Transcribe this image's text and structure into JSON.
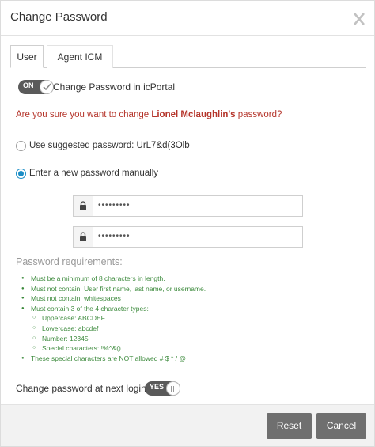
{
  "dialog": {
    "title": "Change Password",
    "close_icon": "close-icon"
  },
  "tabs": [
    {
      "label": "User",
      "active": true
    },
    {
      "label": "Agent ICM",
      "active": false
    }
  ],
  "portal_toggle": {
    "state_label": "ON",
    "label": "Change Password in icPortal",
    "enabled": true
  },
  "confirmation": {
    "prefix": "Are you sure you want to change ",
    "user": "Lionel Mclaughlin's",
    "suffix": " password?"
  },
  "options": {
    "suggested": {
      "label": "Use suggested password: UrL7&d(3Olb",
      "selected": false
    },
    "manual": {
      "label": "Enter a new password manually",
      "selected": true
    }
  },
  "password_fields": {
    "new_value": "•••••••••",
    "confirm_value": "•••••••••"
  },
  "requirements": {
    "title": "Password requirements:",
    "items": [
      "Must be a minimum of 8 characters in length.",
      "Must not contain: User first name, last name, or username.",
      "Must not contain: whitespaces",
      "Must contain 3 of the 4 character types:"
    ],
    "types": [
      "Uppercase: ABCDEF",
      "Lowercase: abcdef",
      "Number: 12345",
      "Special characters: !%^&()"
    ],
    "not_allowed": "These special characters are NOT allowed # $ * / @"
  },
  "next_login": {
    "label": "Change password at next login",
    "state_label": "YES",
    "enabled": true
  },
  "footer": {
    "reset_label": "Reset",
    "cancel_label": "Cancel"
  },
  "colors": {
    "warning_text": "#b5352b",
    "requirement_text": "#3c8a3c",
    "radio_selected": "#1a8dc6",
    "button_bg": "#6f6f6f",
    "toggle_bg": "#5a5a5a"
  }
}
